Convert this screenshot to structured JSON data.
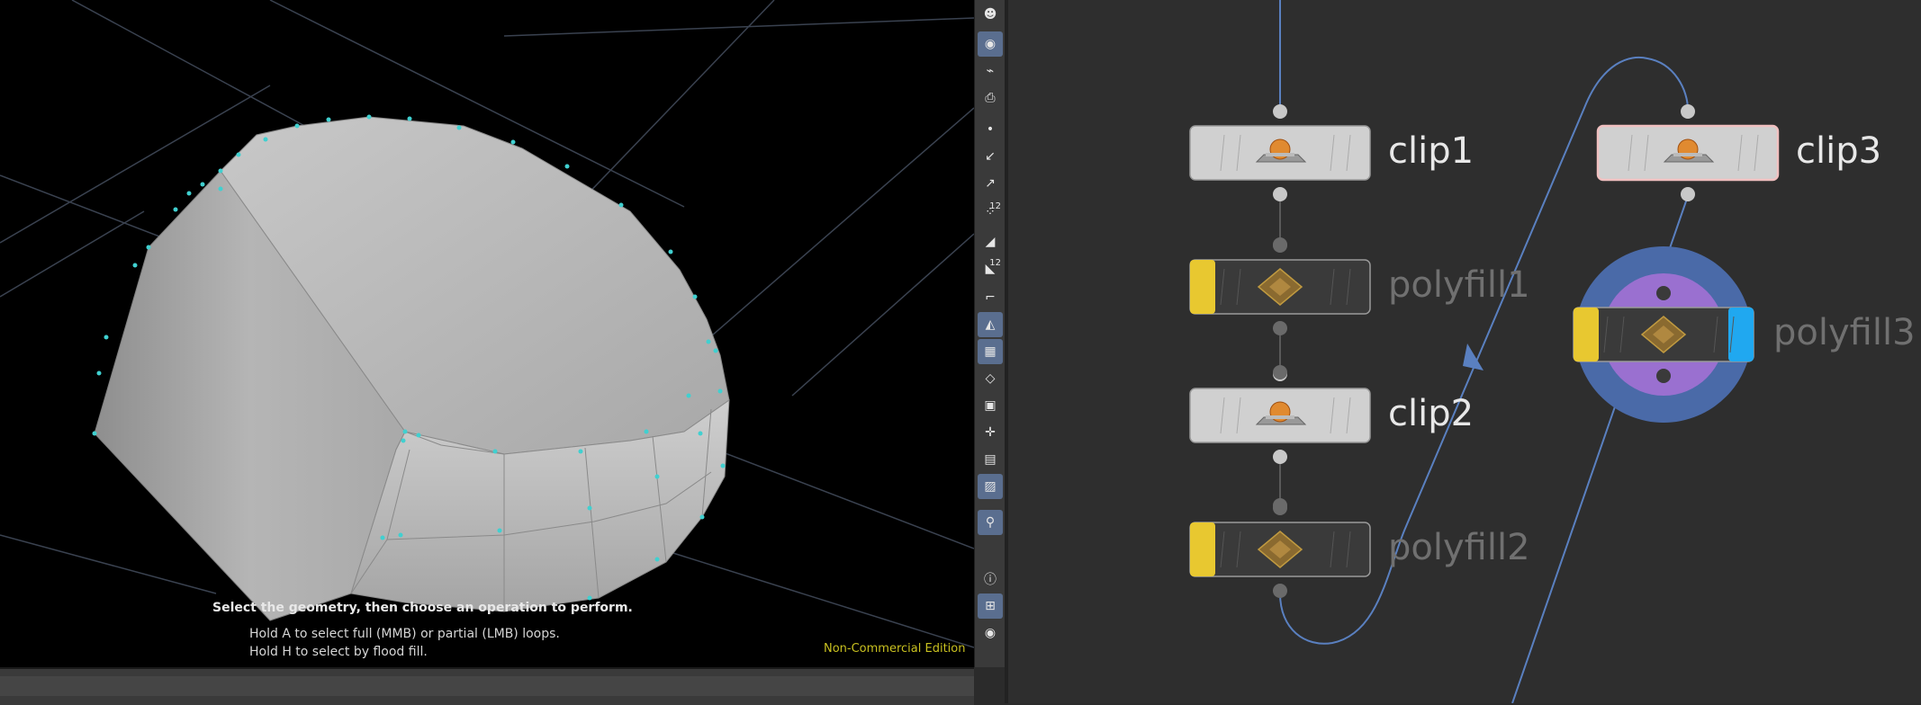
{
  "viewport": {
    "hint_title": "Select the geometry, then choose an operation to perform.",
    "hint_lines": [
      "Hold A to select full (MMB) or partial (LMB) loops.",
      "Hold H to select by flood fill."
    ],
    "edition_label": "Non-Commercial Edition",
    "colors": {
      "background": "#000000",
      "grid": "#3a4250",
      "mesh": "#b8b8b8",
      "points": "#40d0d0"
    }
  },
  "toolbar": {
    "items": [
      {
        "icon": "pose-icon",
        "active": false
      },
      {
        "icon": "view-camera-icon",
        "active": true
      },
      {
        "icon": "camera-link-icon",
        "active": false
      },
      {
        "icon": "snapshot-camera-icon",
        "active": false
      },
      {
        "icon": "point-display-icon",
        "active": false
      },
      {
        "icon": "normals-icon",
        "active": false
      },
      {
        "icon": "point-normals-icon",
        "active": false
      },
      {
        "icon": "point-numbers-icon",
        "number": "12",
        "active": false
      },
      {
        "icon": "primitive-display-icon",
        "active": false
      },
      {
        "icon": "primitive-numbers-icon",
        "number": "12",
        "active": false
      },
      {
        "icon": "edges-icon",
        "active": false
      },
      {
        "icon": "shaded-icon",
        "active": true
      },
      {
        "icon": "uv-checker-icon",
        "active": true
      },
      {
        "icon": "wireframe-icon",
        "active": false
      },
      {
        "icon": "texture-icon",
        "active": false
      },
      {
        "icon": "snap-icon",
        "active": false
      },
      {
        "icon": "layer-icon",
        "active": false
      },
      {
        "icon": "background-image-icon",
        "active": true
      },
      {
        "icon": "location-icon",
        "active": true
      },
      {
        "icon": "info-icon",
        "active": false
      },
      {
        "icon": "quad-view-icon",
        "active": true
      },
      {
        "icon": "eye-icon",
        "active": false
      }
    ]
  },
  "network": {
    "nodes": [
      {
        "id": "clip1",
        "label": "clip1",
        "type": "clip",
        "state": "normal"
      },
      {
        "id": "polyfill1",
        "label": "polyfill1",
        "type": "polyfill",
        "state": "bypass"
      },
      {
        "id": "clip2",
        "label": "clip2",
        "type": "clip",
        "state": "normal"
      },
      {
        "id": "polyfill2",
        "label": "polyfill2",
        "type": "polyfill",
        "state": "bypass"
      },
      {
        "id": "clip3",
        "label": "clip3",
        "type": "clip",
        "state": "selected"
      },
      {
        "id": "polyfill3",
        "label": "polyfill3",
        "type": "polyfill",
        "state": "display-render"
      }
    ],
    "colors": {
      "wire": "#5a80c0",
      "bypass_flag": "#e8c830",
      "display_flag": "#20a8f0",
      "render_ring": "#4a6aa8",
      "template_ring": "#9a70d0",
      "node_body": "#d0d0d0",
      "node_body_dark": "#3a3a3a"
    }
  }
}
